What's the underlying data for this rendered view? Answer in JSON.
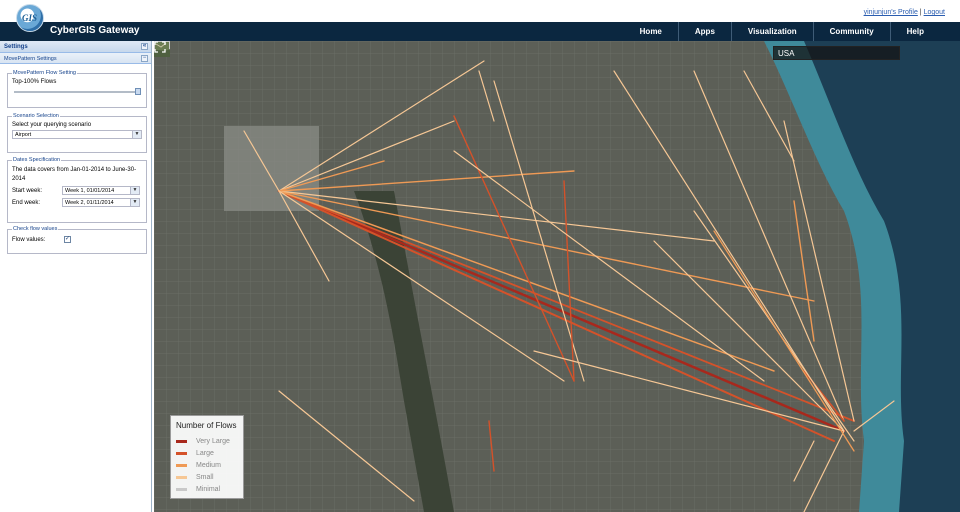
{
  "header": {
    "app_title": "CyberGIS Gateway",
    "logo_text": "GIS",
    "profile_link": "yinjunjun's Profile",
    "separator": "|",
    "logout_link": "Logout"
  },
  "nav": [
    "Home",
    "Apps",
    "Visualization",
    "Community",
    "Help"
  ],
  "sidebar": {
    "title": "Settings",
    "collapse_glyph": "«",
    "subpanel_title": "MovePattern Settings",
    "subpanel_toggle": "−",
    "flow_setting": {
      "legend": "MovePattern Flow Setting",
      "label": "Top-100% Flows",
      "slider_fraction": 1.0
    },
    "scenario": {
      "legend": "Scenario Selection",
      "label": "Select your querying scenario",
      "selected": "Airport"
    },
    "dates": {
      "legend": "Dates Specification",
      "coverage_text": "The data covers from Jan-01-2014 to June-30-2014",
      "start_label": "Start week:",
      "start_value": "Week 1, 01/01/2014",
      "end_label": "End week:",
      "end_value": "Week 2, 01/11/2014"
    },
    "check_flows": {
      "legend": "Check flow values",
      "label": "Flow values:",
      "checked": true
    }
  },
  "map": {
    "search_value": "USA",
    "icons": [
      "search-icon",
      "home-icon",
      "globe-icon",
      "basemap-thumbnail"
    ],
    "legend": {
      "title": "Number of Flows",
      "items": [
        {
          "label": "Very Large",
          "color": "#a8281c"
        },
        {
          "label": "Large",
          "color": "#d4522a"
        },
        {
          "label": "Medium",
          "color": "#ef9a55"
        },
        {
          "label": "Small",
          "color": "#f6c795"
        },
        {
          "label": "Minimal",
          "color": "#c9c9c9"
        }
      ]
    }
  }
}
